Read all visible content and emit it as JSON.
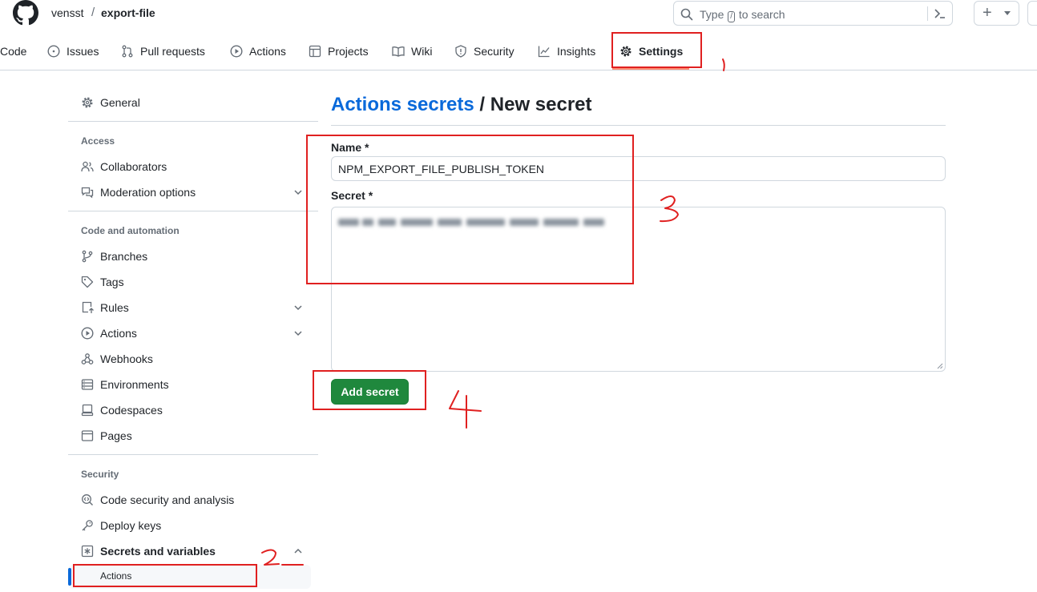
{
  "header": {
    "owner": "vensst",
    "separator": "/",
    "repo": "export-file",
    "search": {
      "before": "Type",
      "key": "/",
      "after": "to search"
    },
    "create_symbol": "+"
  },
  "repo_tabs": [
    {
      "label": "Code",
      "icon": "code-icon"
    },
    {
      "label": "Issues",
      "icon": "issue-opened-icon"
    },
    {
      "label": "Pull requests",
      "icon": "git-pull-request-icon"
    },
    {
      "label": "Actions",
      "icon": "play-icon"
    },
    {
      "label": "Projects",
      "icon": "table-icon"
    },
    {
      "label": "Wiki",
      "icon": "book-icon"
    },
    {
      "label": "Security",
      "icon": "shield-icon"
    },
    {
      "label": "Insights",
      "icon": "graph-icon"
    },
    {
      "label": "Settings",
      "icon": "gear-icon",
      "selected": true
    }
  ],
  "sidebar": {
    "general": "General",
    "access_heading": "Access",
    "collaborators": "Collaborators",
    "moderation": "Moderation options",
    "automation_heading": "Code and automation",
    "branches": "Branches",
    "tags": "Tags",
    "rules": "Rules",
    "actions": "Actions",
    "webhooks": "Webhooks",
    "environments": "Environments",
    "codespaces": "Codespaces",
    "pages": "Pages",
    "security_heading": "Security",
    "code_security": "Code security and analysis",
    "deploy_keys": "Deploy keys",
    "secrets_variables": "Secrets and variables",
    "secrets_actions": "Actions"
  },
  "main": {
    "breadcrumb_link": "Actions secrets",
    "breadcrumb_sep": " / ",
    "title": "New secret",
    "name_label": "Name *",
    "name_value": "NPM_EXPORT_FILE_PUBLISH_TOKEN",
    "secret_label": "Secret *",
    "add_button": "Add secret"
  },
  "annotations": {
    "color": "#e02020",
    "step_labels": [
      "1",
      "2",
      "3",
      "4"
    ]
  },
  "colors": {
    "link": "#0969da",
    "primary_button": "#1f883d",
    "selected_tab_underline": "#fd8c73",
    "annotation": "#e02020"
  }
}
